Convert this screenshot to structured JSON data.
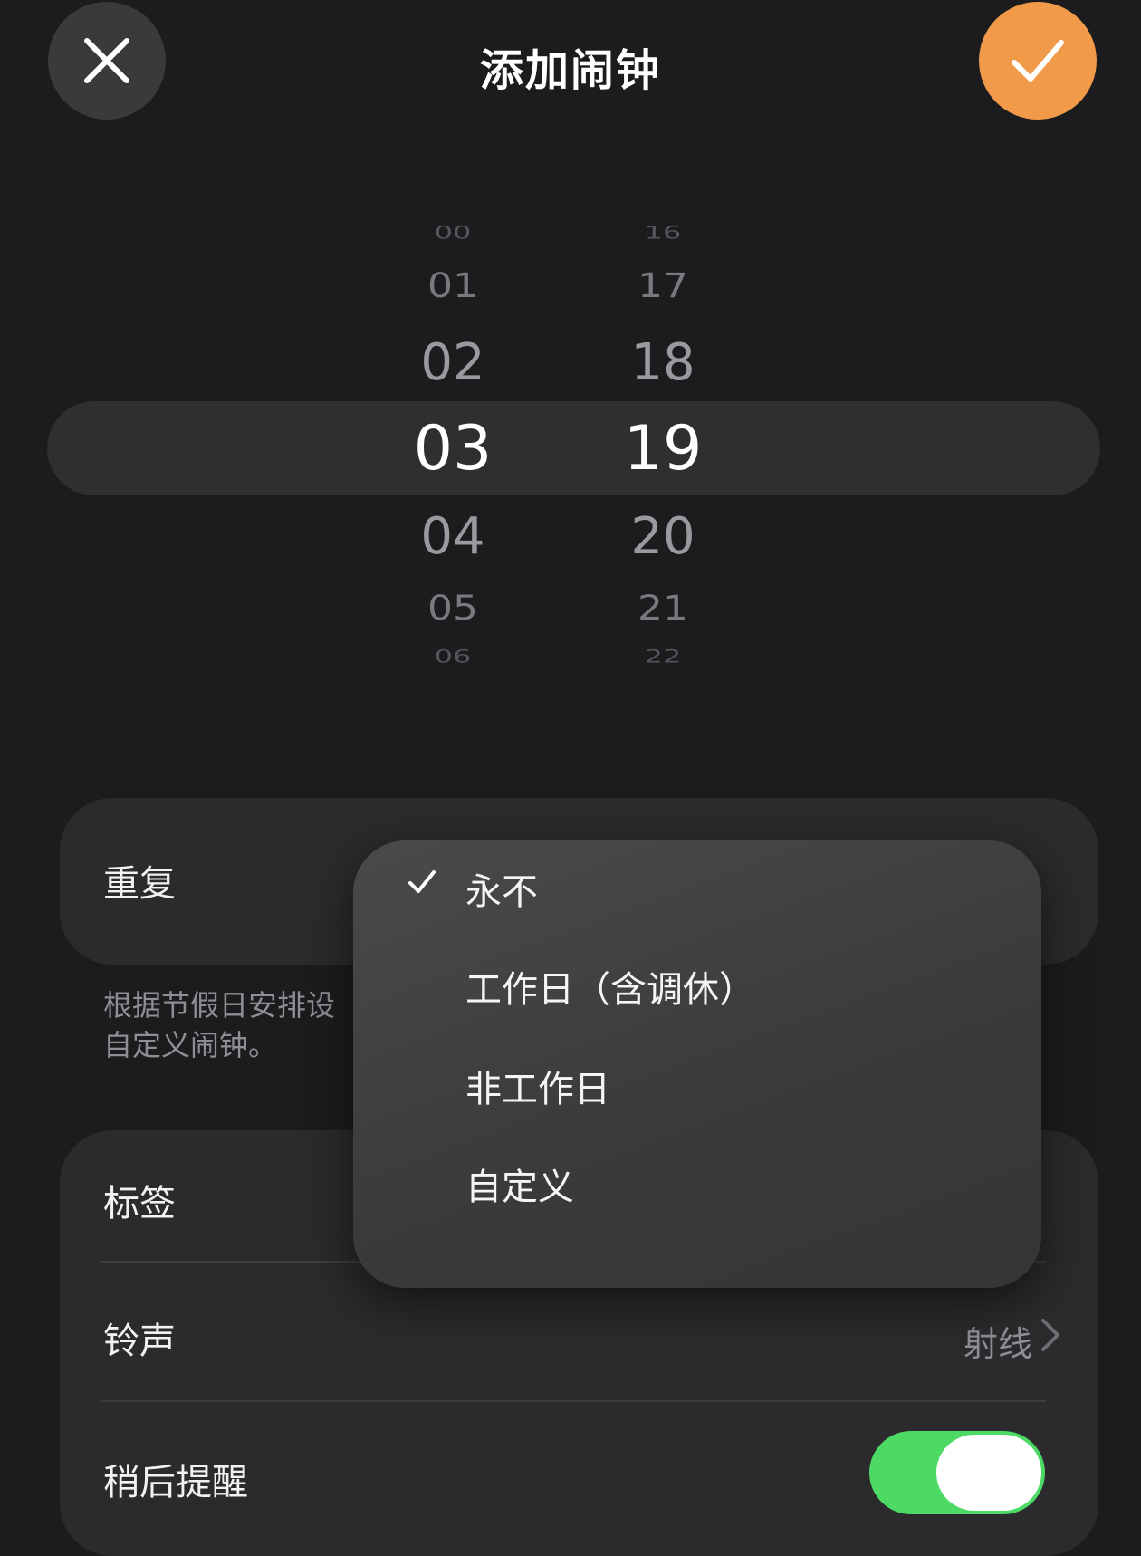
{
  "header": {
    "title": "添加闹钟"
  },
  "time_picker": {
    "hours": [
      "00",
      "01",
      "02",
      "03",
      "04",
      "05",
      "06"
    ],
    "minutes": [
      "16",
      "17",
      "18",
      "19",
      "20",
      "21",
      "22"
    ],
    "selected_hour": "03",
    "selected_minute": "19"
  },
  "repeat": {
    "label": "重复",
    "help_line1": "根据节假日安排设",
    "help_line2": "自定义闹钟。"
  },
  "repeat_menu": {
    "items": [
      {
        "label": "永不",
        "checked": true
      },
      {
        "label": "工作日（含调休）",
        "checked": false
      },
      {
        "label": "非工作日",
        "checked": false
      },
      {
        "label": "自定义",
        "checked": false
      }
    ]
  },
  "settings": {
    "label_row": {
      "label": "标签"
    },
    "ringtone_row": {
      "label": "铃声",
      "value": "射线"
    },
    "snooze_row": {
      "label": "稍后提醒",
      "enabled": true
    }
  },
  "colors": {
    "background": "#1c1c1e",
    "accent": "#f09a4a",
    "toggle_on": "#4cd964"
  }
}
